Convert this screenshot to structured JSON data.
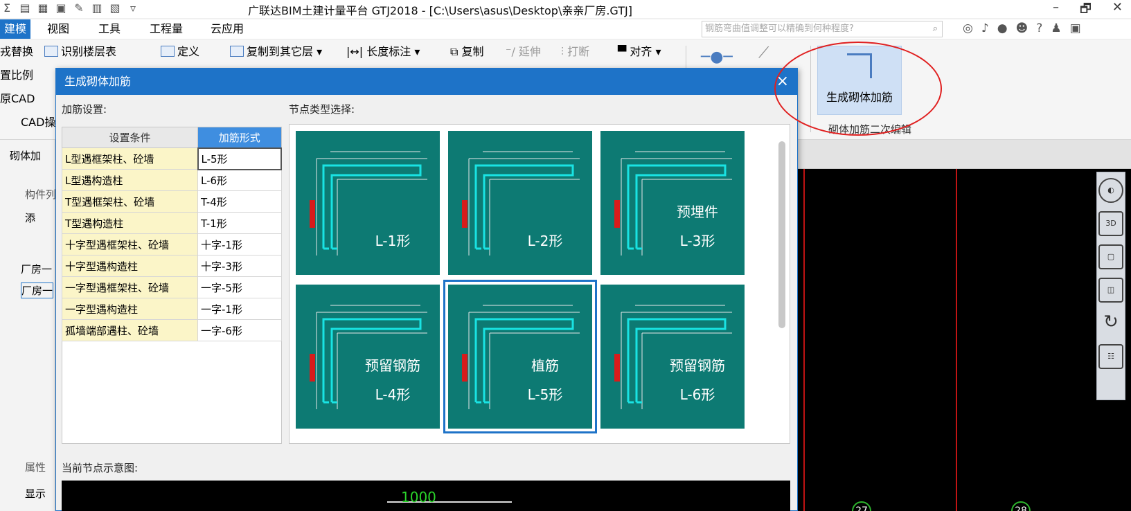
{
  "app": {
    "title": "广联达BIM土建计量平台 GTJ2018 - [C:\\Users\\asus\\Desktop\\亲亲厂房.GTJ]",
    "window_controls": [
      "–",
      "🗗",
      "✕"
    ]
  },
  "menu": {
    "items": [
      "建模",
      "视图",
      "工具",
      "工程量",
      "云应用"
    ],
    "search_placeholder": "钢筋弯曲值调整可以精确到何种程度?"
  },
  "ribbon": {
    "left_col": [
      "戎替换",
      "置比例",
      "原CAD",
      "CAD操"
    ],
    "identify_floors": "识别楼层表",
    "define": "定义",
    "copy_to_floor": "复制到其它层",
    "length_mark": "长度标注",
    "copy": "复制",
    "extend": "延伸",
    "break": "打断",
    "align": "对齐",
    "generate_masonry": "生成砌体加筋",
    "group_label": "砌体加筋二次编辑"
  },
  "left_panel": {
    "dropdown": "砌体加",
    "component_tab": "构件列",
    "add": "添",
    "item1": "厂房一",
    "item2": "厂房一",
    "properties": "属性",
    "show": "显示"
  },
  "dialog": {
    "title": "生成砌体加筋",
    "close": "×",
    "settings_label": "加筋设置:",
    "node_type_label": "节点类型选择:",
    "current_node_label": "当前节点示意图:",
    "table": {
      "headers": [
        "设置条件",
        "加筋形式"
      ],
      "rows": [
        [
          "L型遇框架柱、砼墙",
          "L-5形"
        ],
        [
          "L型遇构造柱",
          "L-6形"
        ],
        [
          "T型遇框架柱、砼墙",
          "T-4形"
        ],
        [
          "T型遇构造柱",
          "T-1形"
        ],
        [
          "十字型遇框架柱、砼墙",
          "十字-1形"
        ],
        [
          "十字型遇构造柱",
          "十字-3形"
        ],
        [
          "一字型遇框架柱、砼墙",
          "一字-5形"
        ],
        [
          "一字型遇构造柱",
          "一字-1形"
        ],
        [
          "孤墙端部遇柱、砼墙",
          "一字-6形"
        ]
      ]
    },
    "tiles": [
      {
        "label": "L-1形",
        "extra": ""
      },
      {
        "label": "L-2形",
        "extra": ""
      },
      {
        "label": "L-3形",
        "extra": "预埋件"
      },
      {
        "label": "L-4形",
        "extra": "预留钢筋"
      },
      {
        "label": "L-5形",
        "extra": "植筋"
      },
      {
        "label": "L-6形",
        "extra": "预留钢筋"
      }
    ],
    "preview_dim": "1000"
  },
  "canvas": {
    "axis_labels": [
      "27",
      "28"
    ]
  },
  "colors": {
    "accent": "#1e73c8",
    "tile_bg": "#0d7a73",
    "rebar": "#19e3e3",
    "annotation": "#e02020"
  }
}
